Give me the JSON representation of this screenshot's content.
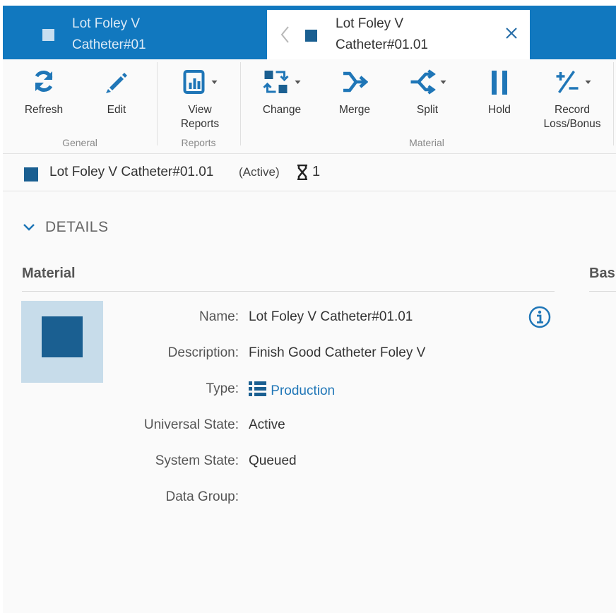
{
  "tabs": {
    "inactive": {
      "title_line1": "Lot Foley V",
      "title_line2": "Catheter#01"
    },
    "active": {
      "title_line1": "Lot Foley V",
      "title_line2": "Catheter#01.01"
    }
  },
  "ribbon": {
    "refresh": "Refresh",
    "edit": "Edit",
    "view_reports_1": "View",
    "view_reports_2": "Reports",
    "change": "Change",
    "merge": "Merge",
    "split": "Split",
    "hold": "Hold",
    "record_1": "Record",
    "record_2": "Loss/Bonus",
    "groups": {
      "general": "General",
      "reports": "Reports",
      "material": "Material"
    }
  },
  "header": {
    "name": "Lot Foley V Catheter#01.01",
    "state": "(Active)",
    "count": "1"
  },
  "details": {
    "toggle_label": "DETAILS",
    "section_material": "Material",
    "section_right": "Bas",
    "fields": [
      {
        "label": "Name:",
        "value": "Lot Foley V Catheter#01.01"
      },
      {
        "label": "Description:",
        "value": "Finish Good Catheter Foley V"
      },
      {
        "label": "Type:",
        "value": "Production"
      },
      {
        "label": "Universal State:",
        "value": "Active"
      },
      {
        "label": "System State:",
        "value": "Queued"
      },
      {
        "label": "Data Group:",
        "value": ""
      }
    ]
  },
  "colors": {
    "brand_blue": "#1178bf",
    "icon_blue": "#1f76b7",
    "dark_blue": "#1a5f91"
  }
}
